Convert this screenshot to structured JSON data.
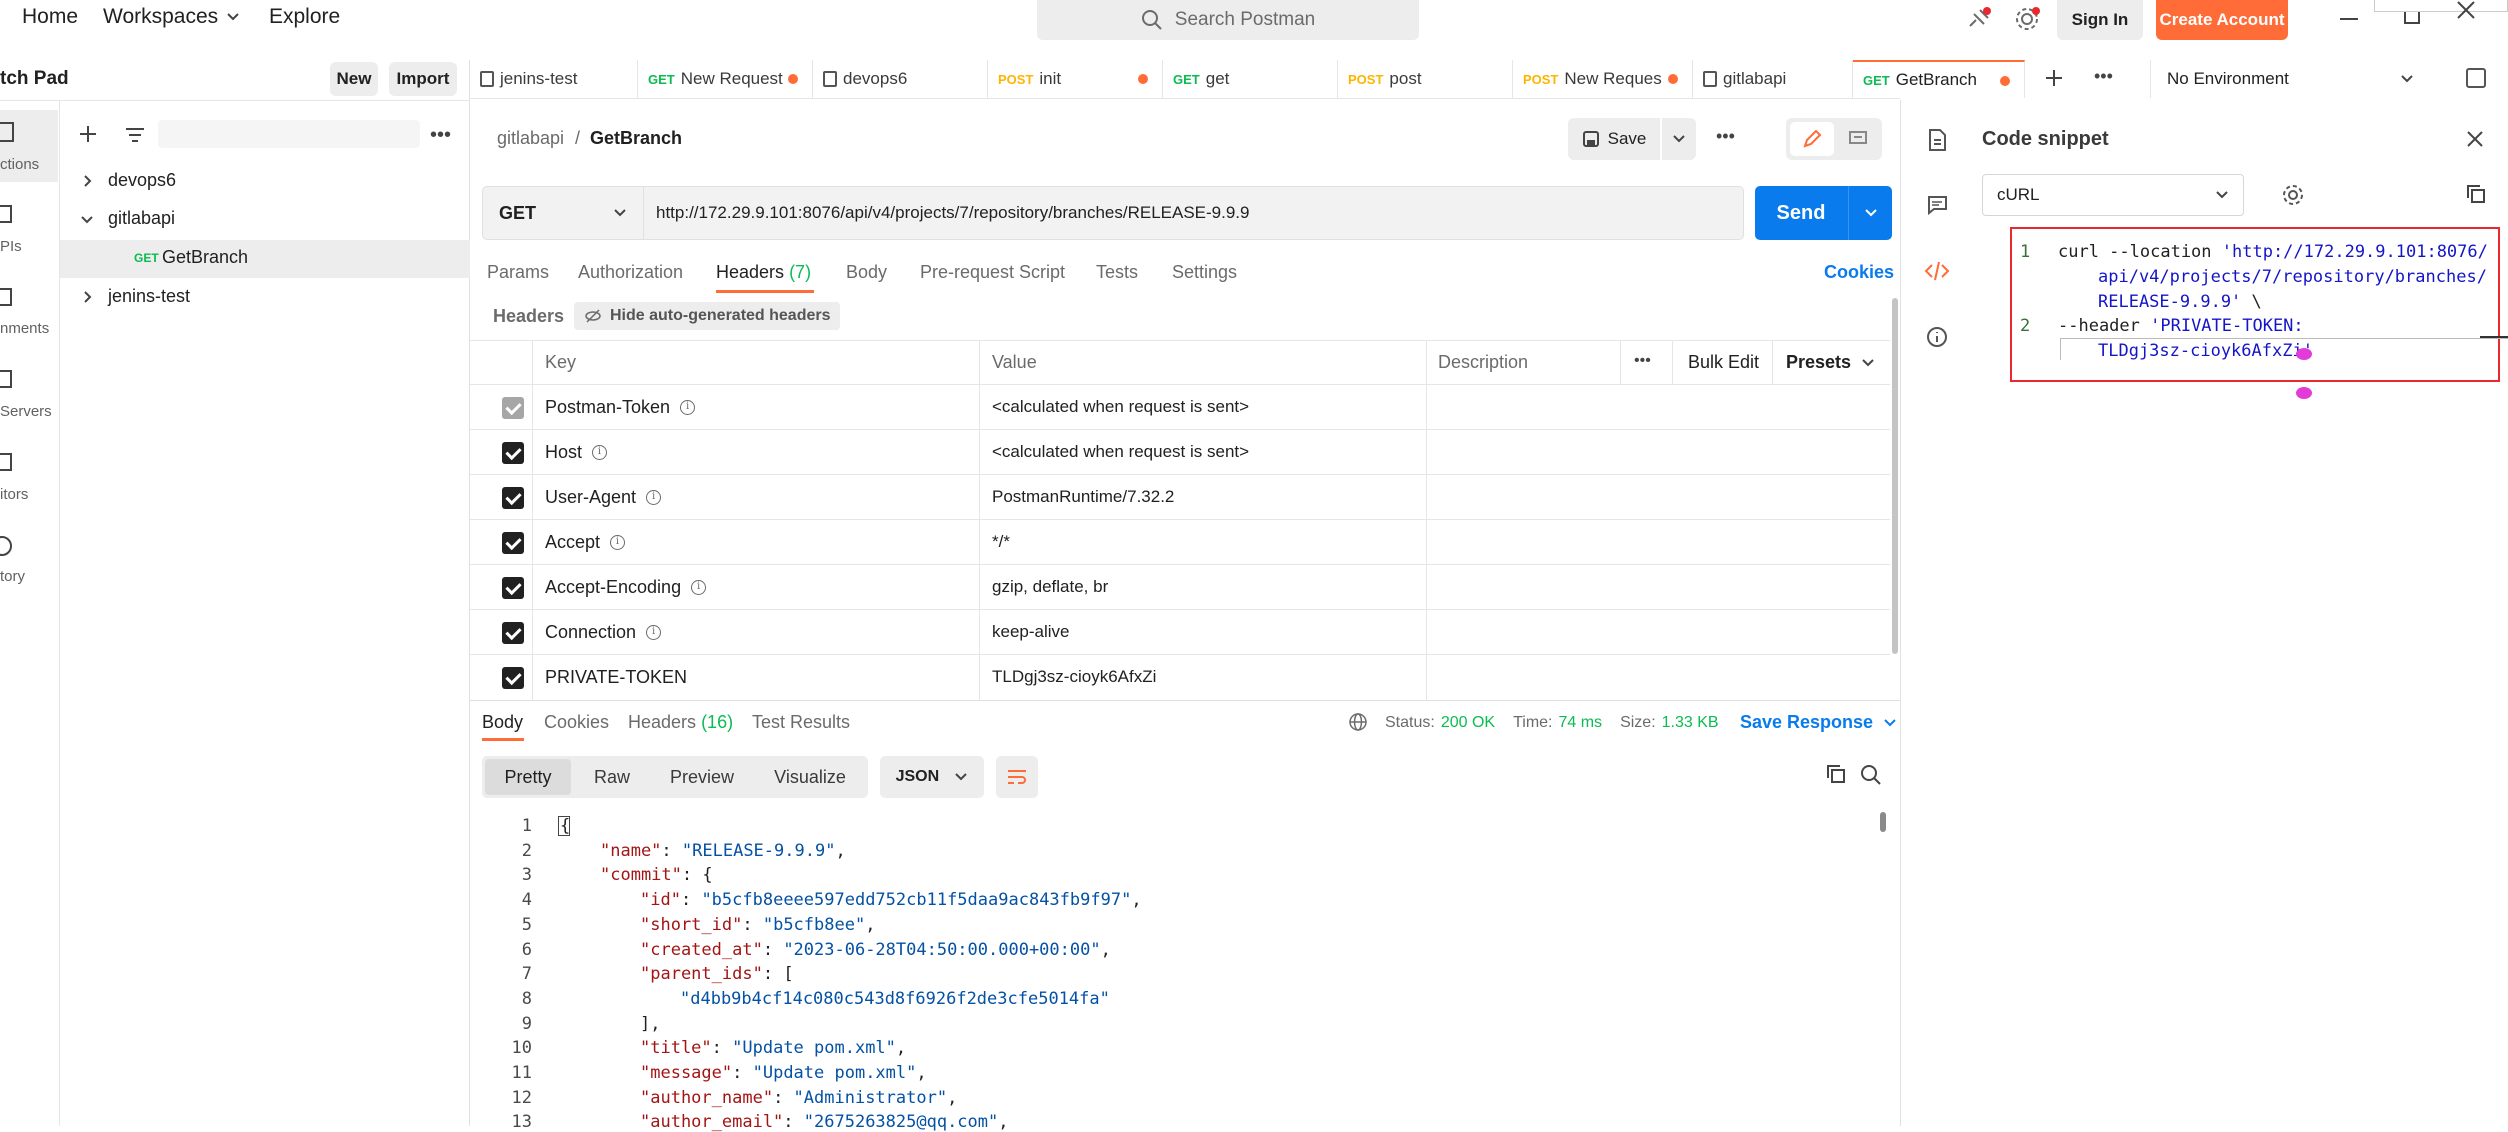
{
  "nav": {
    "home": "Home",
    "workspaces": "Workspaces",
    "explore": "Explore"
  },
  "search": {
    "placeholder": "Search Postman"
  },
  "header": {
    "sign_in": "Sign In",
    "create_account": "Create Account"
  },
  "sidebar": {
    "title": "tch Pad",
    "new": "New",
    "import": "Import",
    "rail": [
      "ctions",
      "PIs",
      "nments",
      "Servers",
      "itors",
      "tory"
    ],
    "tree": [
      {
        "label": "devops6",
        "expanded": false
      },
      {
        "label": "gitlabapi",
        "expanded": true
      },
      {
        "label": "GetBranch",
        "method": "GET"
      },
      {
        "label": "jenins-test",
        "expanded": false
      }
    ]
  },
  "tabs": [
    {
      "method": "",
      "label": "jenins-test",
      "dot": false
    },
    {
      "method": "GET",
      "label": "New Request",
      "dot": true
    },
    {
      "method": "",
      "label": "devops6",
      "dot": false
    },
    {
      "method": "POST",
      "label": "init",
      "dot": true
    },
    {
      "method": "GET",
      "label": "get",
      "dot": false
    },
    {
      "method": "POST",
      "label": "post",
      "dot": false
    },
    {
      "method": "POST",
      "label": "New Reques",
      "dot": true
    },
    {
      "method": "",
      "label": "gitlabapi",
      "dot": false
    },
    {
      "method": "GET",
      "label": "GetBranch",
      "dot": true
    }
  ],
  "environment": "No Environment",
  "request": {
    "breadcrumb_parent": "gitlabapi",
    "breadcrumb_sep": "/",
    "name": "GetBranch",
    "save": "Save",
    "method": "GET",
    "url": "http://172.29.9.101:8076/api/v4/projects/7/repository/branches/RELEASE-9.9.9",
    "send": "Send",
    "subtabs": [
      "Params",
      "Authorization",
      "Headers",
      "(7)",
      "Body",
      "Pre-request Script",
      "Tests",
      "Settings"
    ],
    "cookies": "Cookies",
    "headers_label": "Headers",
    "hide_auto": "Hide auto-generated headers",
    "columns": {
      "key": "Key",
      "value": "Value",
      "description": "Description",
      "bulk_edit": "Bulk Edit",
      "presets": "Presets"
    },
    "rows": [
      {
        "key": "Postman-Token",
        "value": "<calculated when request is sent>",
        "disabled": true
      },
      {
        "key": "Host",
        "value": "<calculated when request is sent>"
      },
      {
        "key": "User-Agent",
        "value": "PostmanRuntime/7.32.2"
      },
      {
        "key": "Accept",
        "value": "*/*"
      },
      {
        "key": "Accept-Encoding",
        "value": "gzip, deflate, br"
      },
      {
        "key": "Connection",
        "value": "keep-alive"
      },
      {
        "key": "PRIVATE-TOKEN",
        "value": "TLDgj3sz-cioyk6AfxZi",
        "noinfo": true
      }
    ]
  },
  "response": {
    "tabs": [
      "Body",
      "Cookies",
      "Headers",
      "(16)",
      "Test Results"
    ],
    "status_label": "Status:",
    "status": "200 OK",
    "time_label": "Time:",
    "time": "74 ms",
    "size_label": "Size:",
    "size": "1.33 KB",
    "save_response": "Save Response",
    "views": [
      "Pretty",
      "Raw",
      "Preview",
      "Visualize"
    ],
    "format": "JSON",
    "lines": [
      {
        "n": "1",
        "t": "{"
      },
      {
        "n": "2",
        "k": "\"name\"",
        "v": "\"RELEASE-9.9.9\"",
        "e": ",",
        "i": 1
      },
      {
        "n": "3",
        "k": "\"commit\"",
        "v": "",
        "e": "{",
        "i": 1
      },
      {
        "n": "4",
        "k": "\"id\"",
        "v": "\"b5cfb8eeee597edd752cb11f5daa9ac843fb9f97\"",
        "e": ",",
        "i": 2
      },
      {
        "n": "5",
        "k": "\"short_id\"",
        "v": "\"b5cfb8ee\"",
        "e": ",",
        "i": 2
      },
      {
        "n": "6",
        "k": "\"created_at\"",
        "v": "\"2023-06-28T04:50:00.000+00:00\"",
        "e": ",",
        "i": 2
      },
      {
        "n": "7",
        "k": "\"parent_ids\"",
        "v": "",
        "e": "[",
        "i": 2
      },
      {
        "n": "8",
        "k": "",
        "v": "\"d4bb9b4cf14c080c543d8f6926f2de3cfe5014fa\"",
        "e": "",
        "i": 3
      },
      {
        "n": "9",
        "t": "],",
        "i": 2
      },
      {
        "n": "10",
        "k": "\"title\"",
        "v": "\"Update pom.xml\"",
        "e": ",",
        "i": 2
      },
      {
        "n": "11",
        "k": "\"message\"",
        "v": "\"Update pom.xml\"",
        "e": ",",
        "i": 2
      },
      {
        "n": "12",
        "k": "\"author_name\"",
        "v": "\"Administrator\"",
        "e": ",",
        "i": 2
      },
      {
        "n": "13",
        "k": "\"author_email\"",
        "v": "\"2675263825@qq.com\"",
        "e": ",",
        "i": 2
      }
    ]
  },
  "snippet": {
    "title": "Code snippet",
    "language": "cURL",
    "l1_num": "1",
    "l1a": "curl --location ",
    "l1b": "'http://172.29.9.101:8076/",
    "l1c": "api/v4/projects/7/repository/branches/",
    "l1d": "RELEASE-9.9.9'",
    "l1e": " \\",
    "l2_num": "2",
    "l2a": "--header ",
    "l2b": "'PRIVATE-TOKEN:",
    "l2c": "TLDgj3sz-cioyk6AfxZi'"
  },
  "colors": {
    "accent": "#ff6c37",
    "send": "#097bed",
    "highlight": "#e8292f"
  }
}
